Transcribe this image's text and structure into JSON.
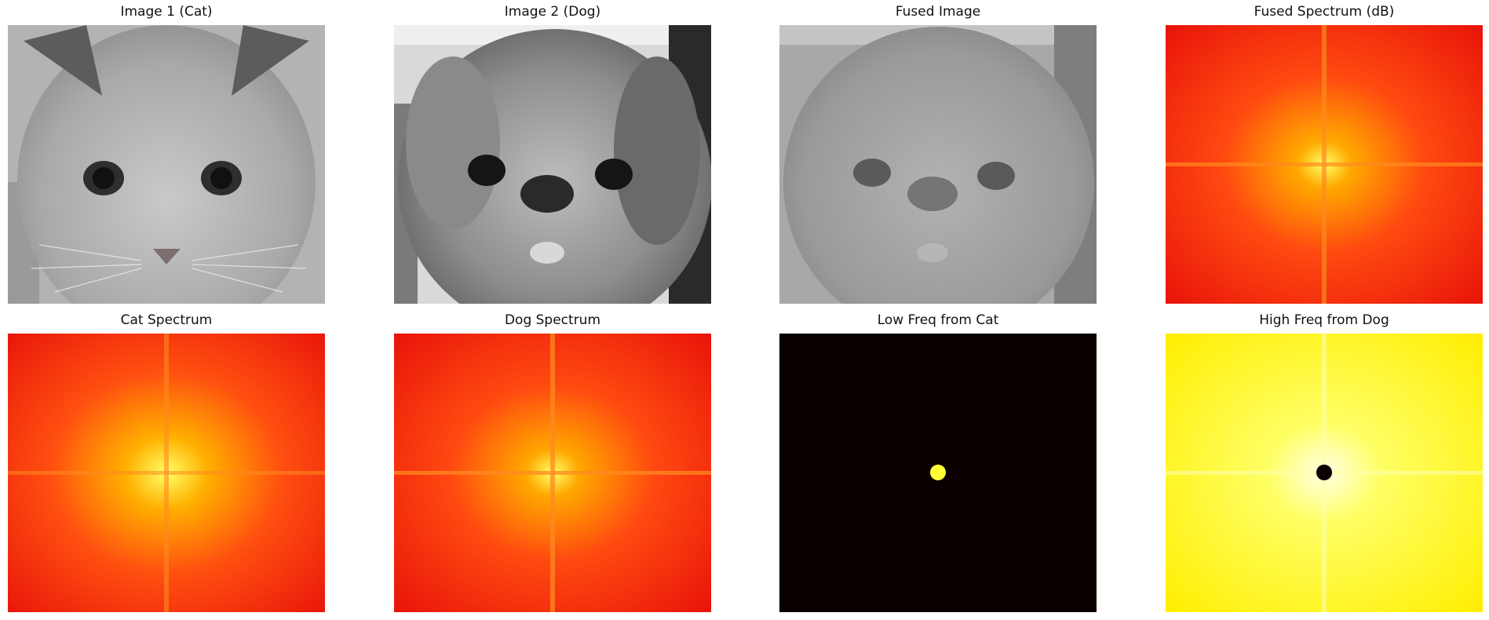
{
  "panels": [
    {
      "title": "Image 1 (Cat)",
      "kind": "photo-gray"
    },
    {
      "title": "Image 2 (Dog)",
      "kind": "photo-gray"
    },
    {
      "title": "Fused Image",
      "kind": "photo-gray"
    },
    {
      "title": "Fused Spectrum (dB)",
      "kind": "spectrum-hot"
    },
    {
      "title": "Cat Spectrum",
      "kind": "spectrum-hot"
    },
    {
      "title": "Dog Spectrum",
      "kind": "spectrum-hot"
    },
    {
      "title": "Low Freq from Cat",
      "kind": "mask-low"
    },
    {
      "title": "High Freq from Dog",
      "kind": "mask-high"
    }
  ],
  "colors": {
    "hot_center": "#ffff66",
    "hot_mid": "#ff8800",
    "hot_edge": "#e8140a",
    "mask_dark": "#0b0000",
    "mask_yellow": "#ffff33",
    "gray_light": "#c8c8c8",
    "gray_dark": "#3a3a3a"
  }
}
